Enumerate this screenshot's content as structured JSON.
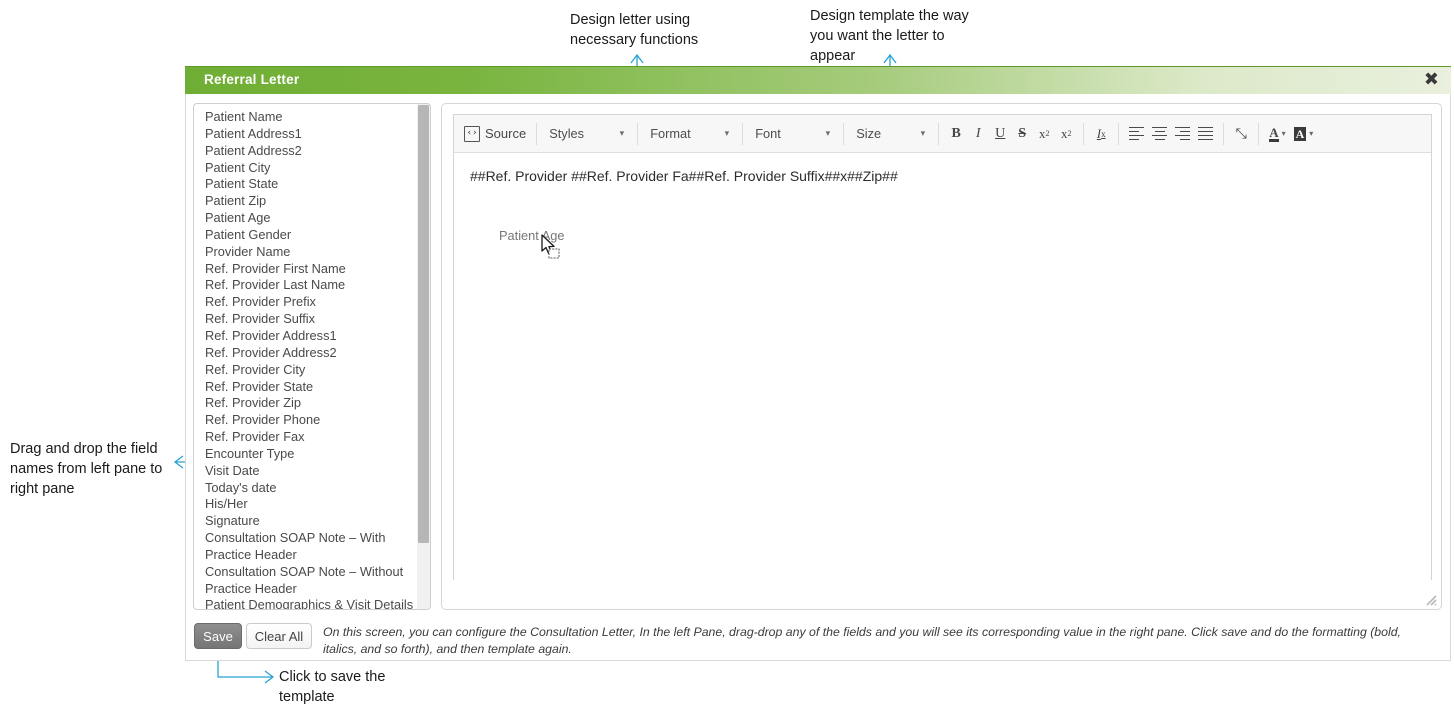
{
  "dialog": {
    "title": "Referral Letter",
    "close_icon": "close-icon",
    "close_label": "✖"
  },
  "field_pane": {
    "name": "merge-field-list",
    "items": [
      "Patient Name",
      "Patient Address1",
      "Patient Address2",
      "Patient City",
      "Patient State",
      "Patient Zip",
      "Patient Age",
      "Patient Gender",
      "Provider Name",
      "Ref. Provider First Name",
      "Ref. Provider Last Name",
      "Ref. Provider Prefix",
      "Ref. Provider Suffix",
      "Ref. Provider Address1",
      "Ref. Provider Address2",
      "Ref. Provider City",
      "Ref. Provider State",
      "Ref. Provider Zip",
      "Ref. Provider Phone",
      "Ref. Provider Fax",
      "Encounter Type",
      "Visit Date",
      "Today's date",
      "His/Her",
      "Signature",
      "Consultation SOAP Note – With",
      "Practice Header",
      "Consultation SOAP Note – Without",
      "Practice Header",
      "Patient Demographics & Visit Details"
    ]
  },
  "toolbar": {
    "source_label": "Source",
    "source_icon_glyph": "‹›",
    "styles_label": "Styles",
    "format_label": "Format",
    "font_label": "Font",
    "size_label": "Size",
    "caret_glyph": "▾",
    "bold_label": "B",
    "italic_label": "I",
    "underline_label": "U",
    "strike_label": "S",
    "subscript_label": "x",
    "subscript_sub": "2",
    "superscript_label": "x",
    "superscript_sup": "2",
    "remove_format_label": "I",
    "remove_format_sub": "x",
    "maximize_glyph": "⤡",
    "text_color_label": "A",
    "bg_color_label": "A",
    "highlight_color": "#1ca0e3"
  },
  "editor": {
    "merge_text": "##Ref. Provider ##Ref. Provider Fa##Ref. Provider Suffix##x##Zip##",
    "drag_ghost_text": "Patient Age"
  },
  "footer": {
    "save_label": "Save",
    "clear_label": "Clear All",
    "help_text": "On this screen, you can configure the Consultation Letter, In the left Pane, drag-drop any of the fields and you will see its corresponding value in the right pane. Click save and do the formatting (bold, italics, and so forth), and then template again."
  },
  "annotations": {
    "design_letter": "Design letter using\nnecessary functions",
    "design_template": "Design template the way\nyou want the letter to\nappear",
    "drag_drop": "Drag and drop the field\nnames from left pane to\nright pane",
    "click_save": "Click to save the\ntemplate",
    "line_color": "#29a3d4"
  }
}
